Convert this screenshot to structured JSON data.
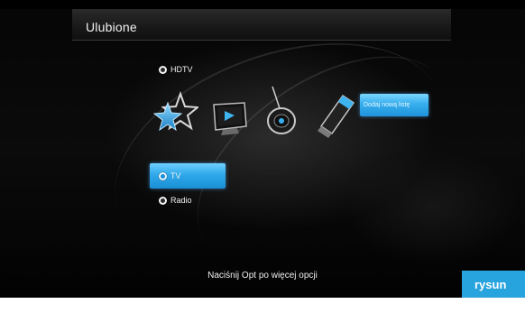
{
  "header": {
    "title": "Ulubione"
  },
  "options": [
    {
      "label": "HDTV",
      "selected": false
    },
    {
      "label": "TV",
      "selected": true
    },
    {
      "label": "Radio",
      "selected": false
    }
  ],
  "icons": [
    {
      "name": "favorites-star-icon"
    },
    {
      "name": "tv-monitor-icon"
    },
    {
      "name": "radio-satellite-icon"
    },
    {
      "name": "usb-stick-icon"
    }
  ],
  "actions": {
    "add_list_label": "Dodaj nową listę"
  },
  "footer": {
    "hint": "Naciśnij Opt po więcej opcji"
  },
  "caption": {
    "label": "rysun"
  },
  "colors": {
    "accent": "#27a3dd",
    "highlight": "#2fa8ea",
    "background": "#050505"
  }
}
